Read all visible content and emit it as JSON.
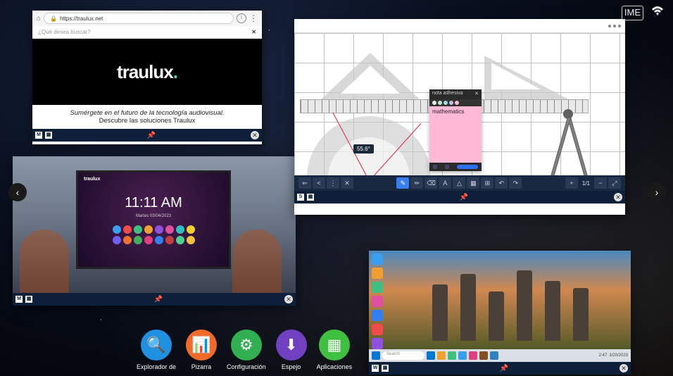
{
  "status": {
    "ime_icon": "⌨",
    "wifi_icon": "wifi"
  },
  "nav": {
    "prev": "‹",
    "next": "›"
  },
  "browser": {
    "lock_icon": "lock",
    "url": "https://traulux.net",
    "menu_icon": "⋮",
    "search_placeholder": "¿Qué desea buscar?",
    "close_search": "✕",
    "brand": "traulux",
    "tagline_line1": "Sumérgete en el futuro de la tecnología audiovisual.",
    "tagline_line2": "Descubre las soluciones Traulux",
    "bar_m": "M",
    "bar_ext": "▦",
    "bar_pin": "📌",
    "bar_close": "✕"
  },
  "image_win": {
    "tv_brand": "traulux",
    "tv_time": "11:11 AM",
    "tv_date": "Martes 03/04/2023",
    "app_colors": [
      "#3a9ff0",
      "#f04a4a",
      "#40c080",
      "#f0a030",
      "#9050e0",
      "#e050a0",
      "#30c0c0",
      "#f0d030",
      "#7060f0",
      "#f07030",
      "#40b060",
      "#e04080",
      "#3080f0",
      "#c04040",
      "#50d090",
      "#f0c040"
    ],
    "bar_m": "M",
    "bar_ext": "▦",
    "bar_pin": "📌",
    "bar_close": "✕"
  },
  "board": {
    "angle_value": "55.6°",
    "sticky_title": "nota adhesiva",
    "sticky_text": "mathematics",
    "sticky_colors": [
      "#f0f0f0",
      "#b8e8d0",
      "#a0d8e8",
      "#c0c0e8",
      "#ffb8d6"
    ],
    "toolbar_icons": [
      "⇐",
      "<",
      "⋮",
      "✕",
      "✎",
      "✏",
      "⌫",
      "A",
      "△",
      "▦",
      "⊞",
      "↶",
      "↷",
      "+",
      "1/1",
      "−",
      "⤢"
    ],
    "page": "1/1",
    "bar_s": "S",
    "bar_ext": "▦",
    "bar_pin": "📌",
    "bar_close": "✕"
  },
  "desktop": {
    "icons": [
      {
        "color": "#3a9ff0"
      },
      {
        "color": "#f0a030"
      },
      {
        "color": "#40c080"
      },
      {
        "color": "#e050a0"
      },
      {
        "color": "#3080f0"
      },
      {
        "color": "#f04a4a"
      },
      {
        "color": "#9050e0"
      }
    ],
    "search_placeholder": "Search",
    "taskbar_icons": [
      "#0078d4",
      "#f0a030",
      "#40c080",
      "#3a9ff0",
      "#e04080",
      "#805020",
      "#3080c0"
    ],
    "time": "2:47",
    "date": "3/20/2023",
    "bar_w": "W",
    "bar_ext": "▦",
    "bar_pin": "📌",
    "bar_close": "✕"
  },
  "dock": [
    {
      "label": "Explorador de",
      "color": "#2090e0",
      "glyph": "🔍"
    },
    {
      "label": "Pizarra",
      "color": "#f06a2a",
      "glyph": "📊"
    },
    {
      "label": "Configuración",
      "color": "#30b050",
      "glyph": "⚙"
    },
    {
      "label": "Espejo",
      "color": "#7040c0",
      "glyph": "⬇"
    },
    {
      "label": "Aplicaciones",
      "color": "#40c040",
      "glyph": "▦"
    }
  ]
}
